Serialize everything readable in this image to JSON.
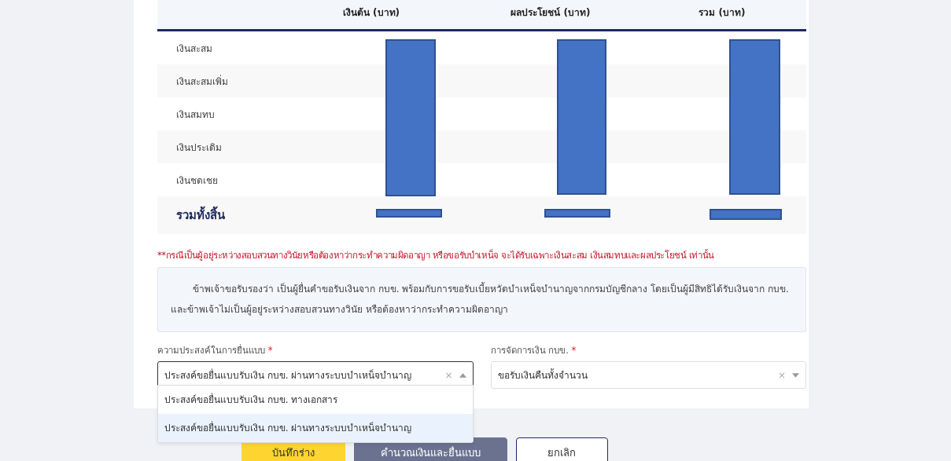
{
  "table": {
    "columns": [
      "",
      "เงินต้น (บาท)",
      "ผลประโยชน์ (บาท)",
      "รวม (บาท)"
    ],
    "rows": [
      {
        "label": "เงินสะสม"
      },
      {
        "label": "เงินสะสมเพิ่ม"
      },
      {
        "label": "เงินสมทบ"
      },
      {
        "label": "เงินประเดิม"
      },
      {
        "label": "เงินชดเชย"
      }
    ],
    "total": {
      "label": "รวมทั้งสิ้น"
    }
  },
  "note": "**กรณีเป็นผู้อยู่ระหว่างสอบสวนทางวินัยหรือต้องหาว่ากระทำความผิดอาญา หรือขอรับบำเหน็จ จะได้รับเฉพาะเงินสะสม เงินสมทบและผลประโยชน์ เท่านั้น",
  "declaration": "ข้าพเจ้าขอรับรองว่า เป็นผู้ยื่นคำขอรับเงินจาก กบข. พร้อมกับการขอรับเบี้ยหวัดบำเหน็จบำนาญจากกรมบัญชีกลาง โดยเป็นผู้มีสิทธิได้รับเงินจาก กบข. และข้าพเจ้าไม่เป็นผู้อยู่ระหว่างสอบสวนทางวินัย หรือต้องหาว่ากระทำความผิดอาญา",
  "fields": [
    {
      "label": "ความประสงค์ในการยื่นแบบ",
      "required_mark": "*",
      "value": "ประสงค์ขอยื่นแบบรับเงิน กบข. ผ่านทางระบบบำเหน็จบำนาญ",
      "clear": "×",
      "expanded": true,
      "options": [
        {
          "label": "ประสงค์ขอยื่นแบบรับเงิน กบข. ทางเอกสาร",
          "selected": false
        },
        {
          "label": "ประสงค์ขอยื่นแบบรับเงิน กบข. ผ่านทางระบบบำเหน็จบำนาญ",
          "selected": true
        }
      ]
    },
    {
      "label": "การจัดการเงิน กบข.",
      "required_mark": "*",
      "value": "ขอรับเงินคืนทั้งจำนวน",
      "clear": "×",
      "expanded": false
    }
  ],
  "buttons": [
    {
      "label": "บันทึกร่าง",
      "kind": "draft"
    },
    {
      "label": "คำนวณเงินและยื่นแบบ",
      "kind": "submit"
    },
    {
      "label": "ยกเลิก",
      "kind": "cancel"
    }
  ]
}
